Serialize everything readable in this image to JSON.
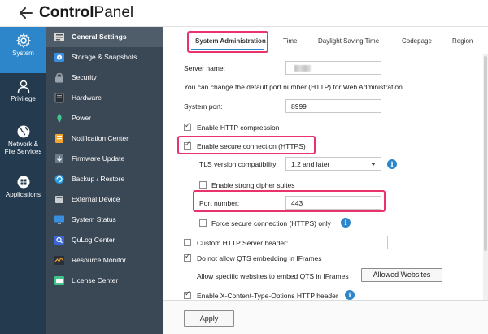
{
  "header": {
    "title_bold": "Control",
    "title_rest": "Panel"
  },
  "rail": {
    "items": [
      {
        "label": "System",
        "active": true
      },
      {
        "label": "Privilege"
      },
      {
        "label_line1": "Network &",
        "label_line2": "File Services"
      },
      {
        "label": "Applications"
      }
    ]
  },
  "subnav": {
    "items": [
      {
        "label": "General Settings",
        "icon": "general-settings-icon",
        "active": true
      },
      {
        "label": "Storage & Snapshots",
        "icon": "storage-icon"
      },
      {
        "label": "Security",
        "icon": "lock-icon"
      },
      {
        "label": "Hardware",
        "icon": "hardware-icon"
      },
      {
        "label": "Power",
        "icon": "power-icon"
      },
      {
        "label": "Notification Center",
        "icon": "notification-icon"
      },
      {
        "label": "Firmware Update",
        "icon": "firmware-icon"
      },
      {
        "label": "Backup / Restore",
        "icon": "backup-icon"
      },
      {
        "label": "External Device",
        "icon": "external-device-icon"
      },
      {
        "label": "System Status",
        "icon": "system-status-icon"
      },
      {
        "label": "QuLog Center",
        "icon": "qulog-icon"
      },
      {
        "label": "Resource Monitor",
        "icon": "resource-monitor-icon"
      },
      {
        "label": "License Center",
        "icon": "license-icon"
      }
    ]
  },
  "tabs": [
    {
      "label": "System Administration",
      "active": true
    },
    {
      "label": "Time"
    },
    {
      "label": "Daylight Saving Time"
    },
    {
      "label": "Codepage"
    },
    {
      "label": "Region"
    }
  ],
  "form": {
    "server_name_label": "Server name:",
    "port_info": "You can change the default port number (HTTP) for Web Administration.",
    "system_port_label": "System port:",
    "system_port_value": "8999",
    "http_compression_label": "Enable HTTP compression",
    "http_compression_checked": true,
    "secure_connection_label": "Enable secure connection (HTTPS)",
    "secure_connection_checked": true,
    "tls_label": "TLS version compatibility:",
    "tls_value": "1.2 and later",
    "strong_cipher_label": "Enable strong cipher suites",
    "strong_cipher_checked": false,
    "port_number_label": "Port number:",
    "port_number_value": "443",
    "force_secure_label": "Force secure connection (HTTPS) only",
    "force_secure_checked": false,
    "custom_header_label": "Custom HTTP Server header:",
    "custom_header_checked": false,
    "custom_header_value": "",
    "no_iframes_label": "Do not allow QTS embedding in IFrames",
    "no_iframes_checked": true,
    "allow_specific_label": "Allow specific websites to embed QTS in IFrames",
    "allowed_websites_button": "Allowed Websites",
    "x_content_label": "Enable X-Content-Type-Options HTTP header",
    "x_content_checked": true
  },
  "footer": {
    "apply_button": "Apply"
  },
  "colors": {
    "highlight": "#e8336d",
    "accent": "#2c86c9",
    "rail_bg": "#243a4f",
    "subnav_bg": "#3a4755"
  }
}
